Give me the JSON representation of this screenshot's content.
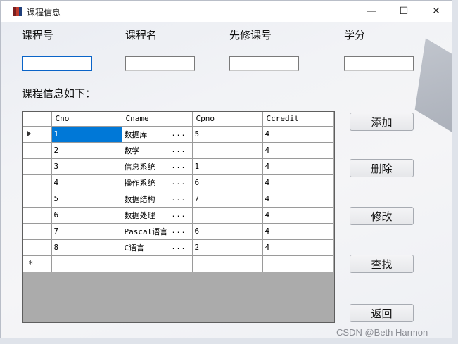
{
  "window": {
    "title": "课程信息",
    "minimize_glyph": "—",
    "maximize_glyph": "☐",
    "close_glyph": "✕",
    "icon": "books-icon",
    "icon_colors": [
      "#7a1f1f",
      "#c0392b",
      "#1f3f7a"
    ]
  },
  "form": {
    "labels": {
      "cno": "课程号",
      "cname": "课程名",
      "cpno": "先修课号",
      "ccredit": "学分"
    },
    "values": {
      "cno": "",
      "cname": "",
      "cpno": "",
      "ccredit": ""
    }
  },
  "section_label": "课程信息如下：",
  "grid": {
    "columns": [
      "Cno",
      "Cname",
      "Cpno",
      "Ccredit"
    ],
    "ellipsis": "...",
    "new_row_marker": "*",
    "rows": [
      {
        "cno": "1",
        "cname": "数据库",
        "cpno": "5",
        "ccredit": "4"
      },
      {
        "cno": "2",
        "cname": "数学",
        "cpno": "",
        "ccredit": "4"
      },
      {
        "cno": "3",
        "cname": "信息系统",
        "cpno": "1",
        "ccredit": "4"
      },
      {
        "cno": "4",
        "cname": "操作系统",
        "cpno": "6",
        "ccredit": "4"
      },
      {
        "cno": "5",
        "cname": "数据结构",
        "cpno": "7",
        "ccredit": "4"
      },
      {
        "cno": "6",
        "cname": "数据处理",
        "cpno": "",
        "ccredit": "4"
      },
      {
        "cno": "7",
        "cname": "Pascal语言",
        "cpno": "6",
        "ccredit": "4"
      },
      {
        "cno": "8",
        "cname": "C语言",
        "cpno": "2",
        "ccredit": "4"
      }
    ]
  },
  "buttons": {
    "add": "添加",
    "delete": "删除",
    "modify": "修改",
    "find": "查找",
    "back": "返回"
  },
  "watermark": "CSDN @Beth Harmon",
  "colors": {
    "selection": "#0078d7",
    "focus_border": "#0a64c8"
  }
}
